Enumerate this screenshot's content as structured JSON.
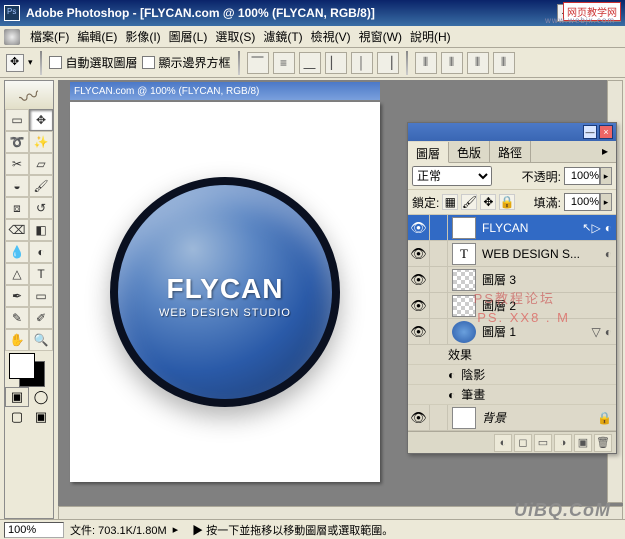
{
  "title": "Adobe Photoshop - [FLYCAN.com @ 100% (FLYCAN, RGB/8)]",
  "menu": {
    "file": "檔案(F)",
    "edit": "編輯(E)",
    "image": "影像(I)",
    "layer": "圖層(L)",
    "select": "選取(S)",
    "filter": "濾鏡(T)",
    "view_c": "檢視(V)",
    "view_w": "視窗(W)",
    "help": "說明(H)"
  },
  "optbar": {
    "auto_select": "自動選取圖層",
    "show_bounds": "顯示邊界方框"
  },
  "doc": {
    "titlebar_label": "FLYCAN.com @ 100% (FLYCAN, RGB/8)",
    "sphere_title": "FLYCAN",
    "sphere_sub": "WEB DESIGN STUDIO"
  },
  "layers": {
    "tab_layers": "圖層",
    "tab_channels": "色版",
    "tab_paths": "路徑",
    "blend_mode": "正常",
    "opacity_label": "不透明:",
    "opacity_value": "100%",
    "lock_label": "鎖定:",
    "fill_label": "填滿:",
    "fill_value": "100%",
    "items": {
      "l0": "FLYCAN",
      "l1": "WEB DESIGN S...",
      "l2": "圖層 3",
      "l3": "圖層 2",
      "l4": "圖層 1",
      "l5": "背景"
    },
    "fx": {
      "effects": "效果",
      "shadow": "陰影",
      "brush": "筆畫"
    }
  },
  "status": {
    "zoom": "100%",
    "docsize": "文件: 703.1K/1.80M",
    "hint": "▶ 按一下並拖移以移動圖層或選取範圍。"
  },
  "watermarks": {
    "top": "网页教学网",
    "top2": "www.webjx.com",
    "bottom": "UiBQ.CoM",
    "mid1": "PS教程论坛",
    "mid2": "PS.      XX8 . M"
  },
  "icons": {
    "move": "✥",
    "marquee": "▭",
    "lasso": "➰",
    "wand": "✨",
    "crop": "✂",
    "slice": "▱",
    "heal": "◒",
    "brush": "🖌",
    "stamp": "⧈",
    "history": "↺",
    "eraser": "⌫",
    "gradient": "◧",
    "blur": "💧",
    "dodge": "◐",
    "path": "△",
    "type": "T",
    "pen": "✒",
    "shape": "▭",
    "notes": "✎",
    "eyedrop": "✐",
    "hand": "✋",
    "zoom": "🔍"
  }
}
